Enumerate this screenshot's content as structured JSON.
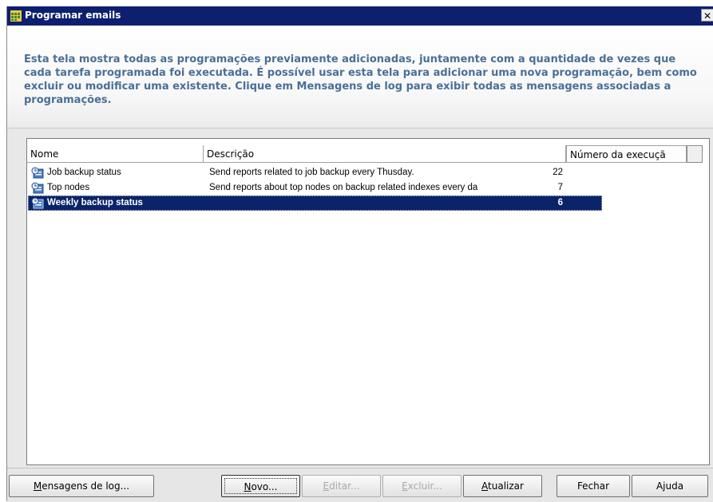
{
  "window": {
    "title": "Programar emails",
    "close_glyph": "✕",
    "icon": "calendar-grid-icon"
  },
  "banner": {
    "description": "Esta tela mostra todas as programações previamente adicionadas, juntamente com a quantidade de vezes que cada tarefa programada foi executada. É possível usar esta tela para adicionar uma nova programação, bem como excluir ou modificar uma existente. Clique em Mensagens de log para exibir todas as mensagens associadas a programações."
  },
  "list": {
    "columns": [
      "Nome",
      "Descrição",
      "Número da execuçã"
    ],
    "rows": [
      {
        "name": "Job backup status",
        "description": "Send reports related to job backup every Thusday.",
        "count": "22",
        "icon": "scheduled-email-icon",
        "selected": false
      },
      {
        "name": "Top nodes",
        "description": "Send reports about top nodes on backup related indexes every da",
        "count": "7",
        "icon": "scheduled-email-icon",
        "selected": false
      },
      {
        "name": "Weekly backup status",
        "description": "",
        "count": "6",
        "icon": "scheduled-email-icon",
        "selected": true
      }
    ]
  },
  "buttons": {
    "log": {
      "label": "Mensagens de log...",
      "mnemonic": "M",
      "rest": "ensagens de log...",
      "enabled": true
    },
    "new": {
      "label": "Novo...",
      "mnemonic": "N",
      "rest": "ovo...",
      "enabled": true
    },
    "edit": {
      "label": "Editar...",
      "mnemonic": "E",
      "rest": "ditar...",
      "enabled": false
    },
    "delete": {
      "label": "Excluir...",
      "mnemonic": "E",
      "rest": "xcluir...",
      "enabled": false
    },
    "refresh": {
      "label": "Atualizar",
      "mnemonic": "A",
      "rest": "tualizar",
      "enabled": true
    },
    "close": {
      "label": "Fechar",
      "enabled": true
    },
    "help": {
      "label": "Ajuda",
      "enabled": true
    }
  },
  "colors": {
    "titlebar": "#0d1f6e",
    "description_text": "#4a6f96",
    "selection": "#0a246a"
  }
}
